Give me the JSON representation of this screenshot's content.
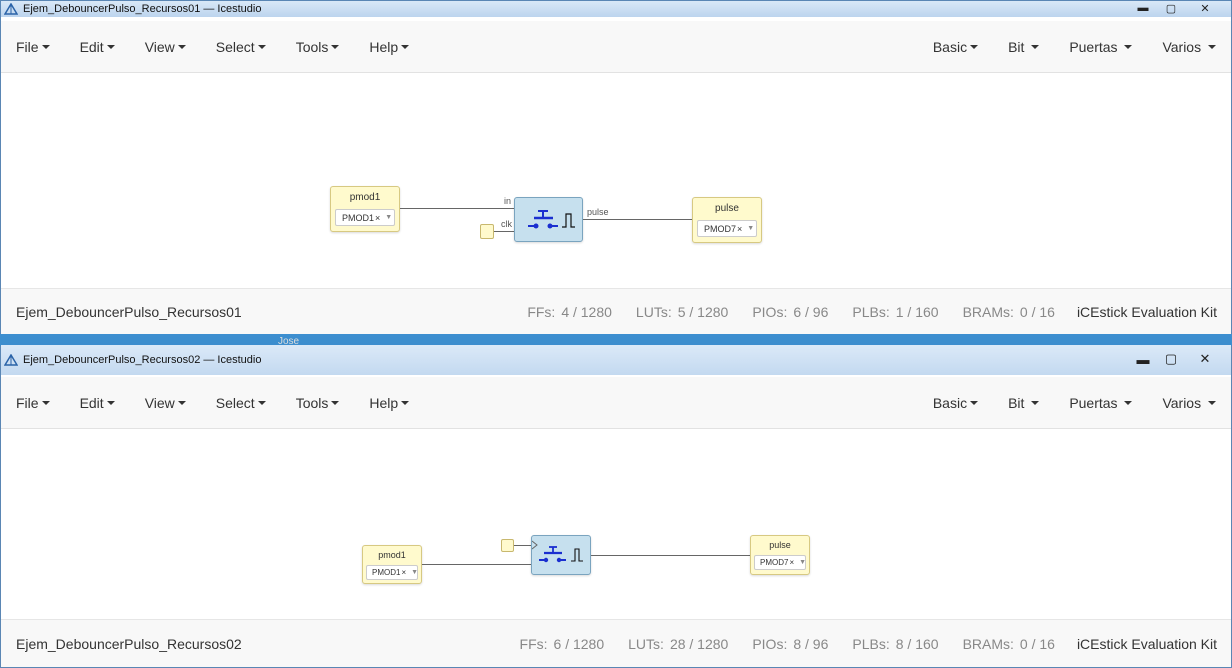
{
  "window1": {
    "title": "Ejem_DebouncerPulso_Recursos01 — Icestudio",
    "menus_left": [
      "File",
      "Edit",
      "View",
      "Select",
      "Tools",
      "Help"
    ],
    "menus_right": [
      "Basic",
      "Bit",
      "Puertas",
      "Varios"
    ],
    "input_block": {
      "label": "pmod1",
      "pin": "PMOD1",
      "pin_suffix": "×"
    },
    "output_block": {
      "label": "pulse",
      "pin": "PMOD7",
      "pin_suffix": "×"
    },
    "ports": {
      "in": "in",
      "clk": "clk",
      "out": "pulse"
    },
    "status": {
      "project": "Ejem_DebouncerPulso_Recursos01",
      "ffs_label": "FFs:",
      "ffs": "4 / 1280",
      "luts_label": "LUTs:",
      "luts": "5 / 1280",
      "pios_label": "PIOs:",
      "pios": "6 / 96",
      "plbs_label": "PLBs:",
      "plbs": "1 / 160",
      "brams_label": "BRAMs:",
      "brams": "0 / 16",
      "board": "iCEstick Evaluation Kit"
    }
  },
  "window2": {
    "title": "Ejem_DebouncerPulso_Recursos02 — Icestudio",
    "menus_left": [
      "File",
      "Edit",
      "View",
      "Select",
      "Tools",
      "Help"
    ],
    "menus_right": [
      "Basic",
      "Bit",
      "Puertas",
      "Varios"
    ],
    "input_block": {
      "label": "pmod1",
      "pin": "PMOD1",
      "pin_suffix": "×"
    },
    "output_block": {
      "label": "pulse",
      "pin": "PMOD7",
      "pin_suffix": "×"
    },
    "status": {
      "project": "Ejem_DebouncerPulso_Recursos02",
      "ffs_label": "FFs:",
      "ffs": "6 / 1280",
      "luts_label": "LUTs:",
      "luts": "28 / 1280",
      "pios_label": "PIOs:",
      "pios": "8 / 96",
      "plbs_label": "PLBs:",
      "plbs": "8 / 160",
      "brams_label": "BRAMs:",
      "brams": "0 / 16",
      "board": "iCEstick Evaluation Kit"
    }
  },
  "desktop_fragment_text": "Jose",
  "colors": {
    "menubar": "#f8f8f8",
    "io_block": "#fffacd",
    "code_block": "#c6e0ee",
    "symbol": "#1a2fd0"
  }
}
